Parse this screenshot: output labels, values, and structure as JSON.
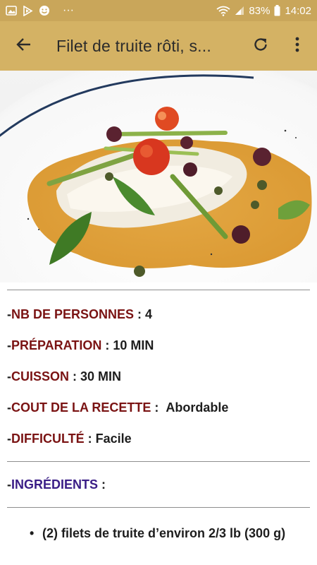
{
  "status_bar": {
    "battery": "83%",
    "time": "14:02",
    "more": "···",
    "icons": [
      "image-icon",
      "play-store-icon",
      "smiley-icon",
      "wifi-icon",
      "signal-icon",
      "battery-icon"
    ]
  },
  "app_bar": {
    "title": "Filet de truite rôti, s...",
    "icons": [
      "back-arrow-icon",
      "refresh-icon",
      "more-vertical-icon"
    ]
  },
  "colors": {
    "status_bar": "#c9a65a",
    "app_bar": "#d4b264",
    "label_red": "#7a1313",
    "label_purple": "#3a1d86"
  },
  "details": [
    {
      "prefix": "- ",
      "label": "NB DE PERSONNES",
      "sep": " : ",
      "value": "4"
    },
    {
      "prefix": "- ",
      "label": "PRÉPARATION",
      "sep": " : ",
      "value": "10 MIN"
    },
    {
      "prefix": "- ",
      "label": "CUISSON",
      "sep": " : ",
      "value": "30 MIN"
    },
    {
      "prefix": "- ",
      "label": "COUT DE LA RECETTE",
      "sep": " :  ",
      "value": "Abordable"
    },
    {
      "prefix": "- ",
      "label": "DIFFICULTÉ",
      "sep": " : ",
      "value": "Facile"
    }
  ],
  "ingredients_heading": {
    "prefix": "- ",
    "label": "INGRÉDIENTS",
    "sep": " :"
  },
  "ingredients": [
    {
      "bullet": "•",
      "text": "(2) filets de truite d’environ 2/3 lb (300 g)"
    }
  ]
}
